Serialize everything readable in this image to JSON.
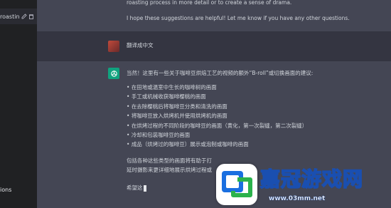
{
  "sidebar": {
    "conversation_label": "roasting",
    "bottom_label": "ions"
  },
  "messages": {
    "top_partial_line": "roasting process in more detail or to create a sense of drama.",
    "top_closing": "I hope these suggestions are helpful! Let me know if you have any other questions.",
    "user_prompt": "翻译成中文",
    "reply_intro": "当然！这里有一些关于咖啡豆烘焙工艺的视频的额外“B-roll”或切换画面的建议:",
    "bullets": [
      "在田地或温室中生长的咖啡树的画面",
      "手工或机械收获咖啡樱桃的画面",
      "在去除樱桃后将咖啡豆分类和清洗的画面",
      "将咖啡豆放入烘烤机并使用烘烤机的画面",
      "在烘烤过程的不同阶段的咖啡豆的画面（黄化，第一次裂缝，第二次裂缝）",
      "冷却和包装咖啡豆的画面",
      "成品（烘烤过的咖啡豆）展示或泡制或咖啡的画面"
    ],
    "reply_para_1": "包括各种这些类型的画面将有助于打",
    "reply_para_2": "延时摄影来更详细地展示烘烤过程或",
    "reply_closing_partial": "希望这"
  },
  "watermark": {
    "brand": "嘉冠游戏网",
    "url": "www.03mm.net"
  },
  "colors": {
    "sidebar_bg": "#202123",
    "assistant_bg": "#444654",
    "user_bg": "#343541",
    "gpt_avatar": "#10a37f"
  }
}
